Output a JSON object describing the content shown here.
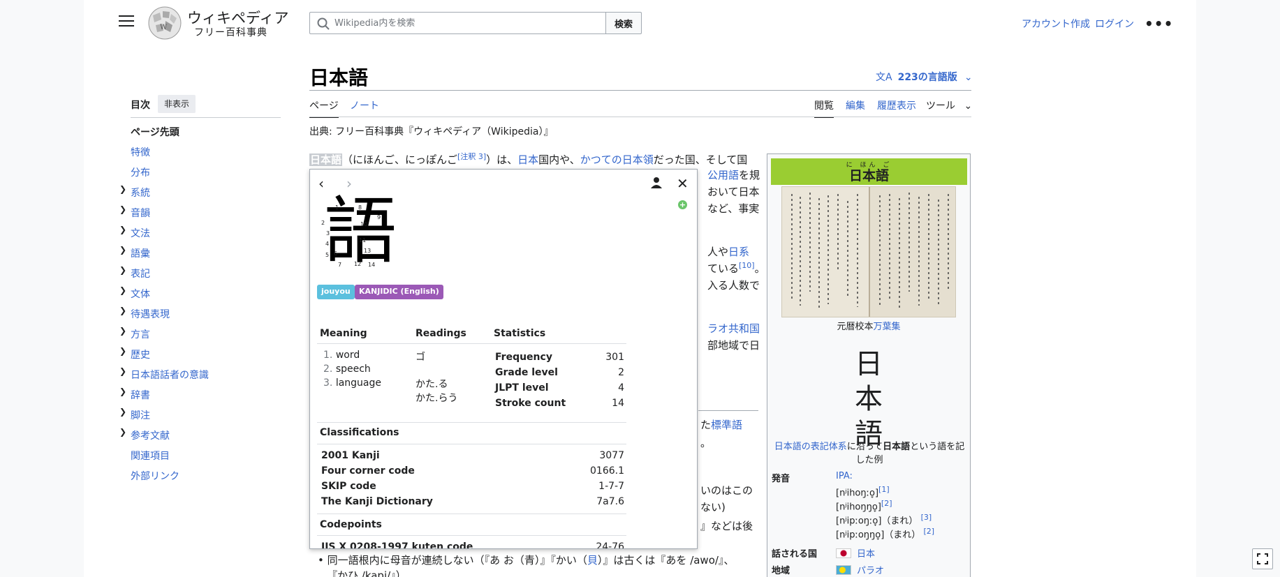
{
  "header": {
    "logo_title": "ウィキペディア",
    "logo_subtitle": "フリー百科事典",
    "search_placeholder": "Wikipedia内を検索",
    "search_button": "検索",
    "create_account": "アカウント作成",
    "login": "ログイン",
    "more": "•••"
  },
  "toc": {
    "title": "目次",
    "hide": "非表示",
    "items": [
      "ページ先頭",
      "特徴",
      "分布",
      "系統",
      "音韻",
      "文法",
      "語彙",
      "表記",
      "文体",
      "待遇表現",
      "方言",
      "歴史",
      "日本語話者の意識",
      "辞書",
      "脚注",
      "参考文献",
      "関連項目",
      "外部リンク"
    ]
  },
  "article": {
    "title": "日本語",
    "languages": "223の言語版",
    "tabs": [
      "ページ",
      "ノート"
    ],
    "actions": [
      "閲覧",
      "編集",
      "履歴表示",
      "ツール"
    ],
    "from": "出典: フリー百科事典『ウィキペディア（Wikipedia）』",
    "line1": {
      "hl": "日本語",
      "a": "（にほんご、にっぽんご",
      "ref": "[注釈 3]",
      "b": "）は、",
      "link1": "日本",
      "c": "国内や、",
      "link2": "かつての日本領",
      "d": "だった国、そして国"
    },
    "frag": {
      "official": "公用語",
      "wo_ki": "を規",
      "japan": "おいて日本",
      "nado": "など、事実",
      "jin_ya": "人や",
      "nikkei": "日系",
      "teiru": "ている",
      "ref10": "[10]",
      "maru": "。",
      "hairu": "入る人数で",
      "palau": "ラオ共和国",
      "bubun": "部地域で日",
      "ta": "た",
      "hyojungo": "標準語",
      "dot": "。",
      "inoha": "いのはこの",
      "nai": "ない)",
      "nadoha": "』などは後"
    },
    "bullet": {
      "a": "同一語根内に母音が連続しない（『あ お（青）』『かい（",
      "link": "貝",
      "b": "）』は古くは『あを /awo/』、",
      "c": "『かひ /kapi/』）"
    }
  },
  "infobox": {
    "ruby": "に ほん ご",
    "title": "日本語",
    "caption1_text": "元暦校本",
    "caption1_link": "万葉集",
    "kanji": [
      "日",
      "本",
      "語"
    ],
    "caption2_link": "日本語の表記体系",
    "caption2_a": "に沿って",
    "caption2_bold": "日本語",
    "caption2_b": "という語を記した例",
    "pron_label": "発音",
    "ipa": "IPA:",
    "pron": [
      "[nʲihoŋːo̞]",
      "[nʲihoŋŋo̞]",
      "[nʲipːoŋːo̞]（まれ）",
      "[nʲipːoŋŋo̞]（まれ）"
    ],
    "pron_refs": [
      "[1]",
      "[2]",
      "[3]",
      "[2]"
    ],
    "spoken_label": "話される国",
    "spoken": "日本",
    "region_label": "地域",
    "region": "パラオ"
  },
  "popup": {
    "prev": "‹",
    "next": "›",
    "close": "✕",
    "kanji": "語",
    "strokes": [
      "1",
      "2",
      "3",
      "4",
      "5",
      "6",
      "7",
      "8",
      "9",
      "10",
      "11",
      "12",
      "13",
      "14"
    ],
    "tags": [
      "jouyou",
      "KANJIDIC (English)"
    ],
    "meaning_h": "Meaning",
    "readings_h": "Readings",
    "stats_h": "Statistics",
    "meanings": [
      "word",
      "speech",
      "language"
    ],
    "readings": [
      "ゴ",
      "かた.る",
      "かた.らう"
    ],
    "stats": [
      {
        "label": "Frequency",
        "value": "301"
      },
      {
        "label": "Grade level",
        "value": "2"
      },
      {
        "label": "JLPT level",
        "value": "4"
      },
      {
        "label": "Stroke count",
        "value": "14"
      }
    ],
    "class_h": "Classifications",
    "classes": [
      {
        "label": "2001 Kanji",
        "value": "3077"
      },
      {
        "label": "Four corner code",
        "value": "0166.1"
      },
      {
        "label": "SKIP code",
        "value": "1-7-7"
      },
      {
        "label": "The Kanji Dictionary",
        "value": "7a7.6"
      }
    ],
    "code_h": "Codepoints",
    "codes": [
      {
        "label": "JIS X 0208-1997 kuten code",
        "value": "24-76"
      }
    ]
  },
  "colors": {
    "link": "#3366cc",
    "infobox_header": "#9acd32",
    "tag_jouyou": "#5bc0de",
    "tag_kanjidic": "#9b59b6"
  }
}
